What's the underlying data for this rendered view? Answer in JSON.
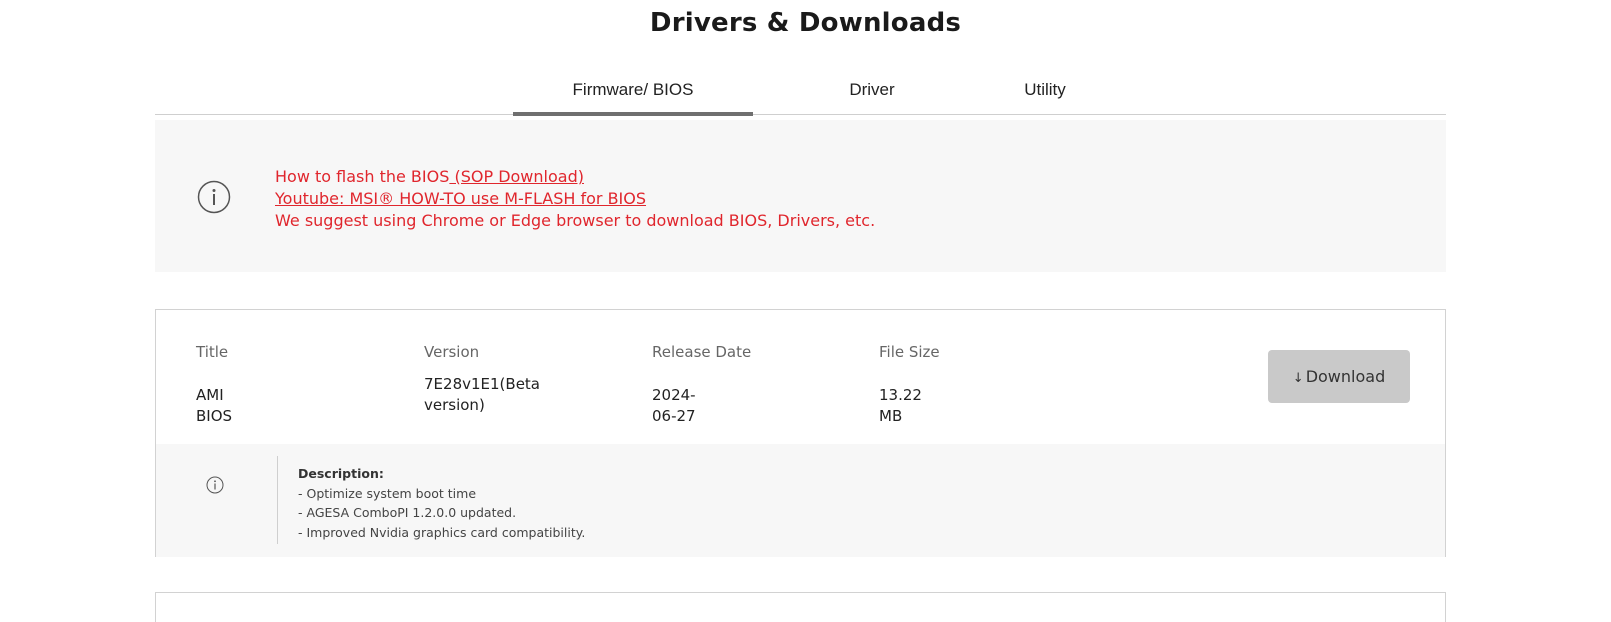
{
  "page": {
    "title": "Drivers & Downloads"
  },
  "tabs": [
    {
      "label": "Firmware/ BIOS",
      "active": true
    },
    {
      "label": "Driver",
      "active": false
    },
    {
      "label": "Utility",
      "active": false
    }
  ],
  "notice": {
    "icon": "info-circle-icon",
    "line1_prefix": "How to flash the BIOS",
    "line1_link": " (SOP Download)",
    "line2_link": "Youtube: MSI® HOW-TO use M-FLASH for BIOS",
    "line3": "We suggest using Chrome or Edge browser to download BIOS, Drivers, etc.",
    "color": "#e0262d"
  },
  "download_item": {
    "headers": {
      "title": "Title",
      "version": "Version",
      "release_date": "Release Date",
      "file_size": "File Size"
    },
    "values": {
      "title": "AMI BIOS",
      "version": "7E28v1E1(Beta version)",
      "release_date": "2024-06-27",
      "file_size": "13.22 MB"
    },
    "download_label": "Download",
    "download_icon": "download-arrow-icon",
    "description": {
      "icon": "info-circle-icon",
      "title": "Description:",
      "lines": [
        "- Optimize system boot time",
        "- AGESA ComboPI 1.2.0.0 updated.",
        "- Improved Nvidia graphics card compatibility."
      ]
    }
  }
}
